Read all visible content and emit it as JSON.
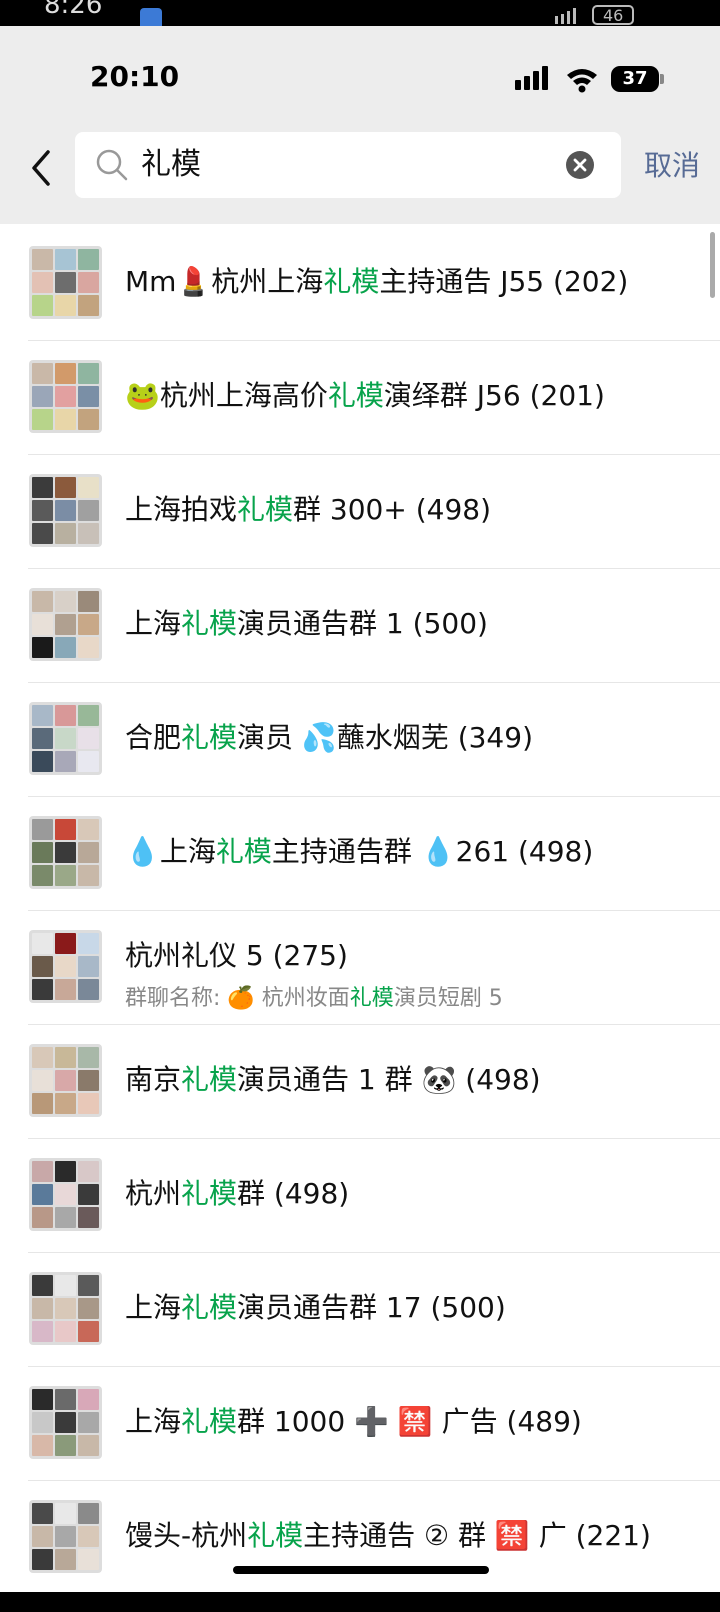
{
  "outer_status": {
    "time": "8:26",
    "battery": "46"
  },
  "status_bar": {
    "time": "20:10",
    "battery": "37"
  },
  "search": {
    "query": "礼模",
    "cancel_label": "取消"
  },
  "results": [
    {
      "pre": "Mm💄杭州上海",
      "hl": "礼模",
      "post": "主持通告 J55 (202)"
    },
    {
      "pre": "🐸杭州上海高价",
      "hl": "礼模",
      "post": "演绎群 J56 (201)"
    },
    {
      "pre": "上海拍戏",
      "hl": "礼模",
      "post": "群 300+ (498)"
    },
    {
      "pre": "上海",
      "hl": "礼模",
      "post": "演员通告群 1 (500)"
    },
    {
      "pre": "合肥",
      "hl": "礼模",
      "post": "演员 💦蘸水烟芜 (349)"
    },
    {
      "pre": "💧上海",
      "hl": "礼模",
      "post": "主持通告群 💧261 (498)"
    },
    {
      "pre": "杭州礼仪 5 (275)",
      "hl": "",
      "post": "",
      "sub_pre": "群聊名称: 🍊 杭州妆面",
      "sub_hl": "礼模",
      "sub_post": "演员短剧 5"
    },
    {
      "pre": "南京",
      "hl": "礼模",
      "post": "演员通告 1 群 🐼 (498)"
    },
    {
      "pre": "杭州",
      "hl": "礼模",
      "post": "群 (498)"
    },
    {
      "pre": "上海",
      "hl": "礼模",
      "post": "演员通告群 17 (500)"
    },
    {
      "pre": "上海",
      "hl": "礼模",
      "post": "群 1000 ➕ 🈲 广告 (489)"
    },
    {
      "pre": "馒头-杭州",
      "hl": "礼模",
      "post": "主持通告 ② 群 🈲 广 (221)"
    }
  ],
  "colors": {
    "highlight": "#07a34b",
    "cancel": "#576b95",
    "header_bg": "#ededed"
  }
}
